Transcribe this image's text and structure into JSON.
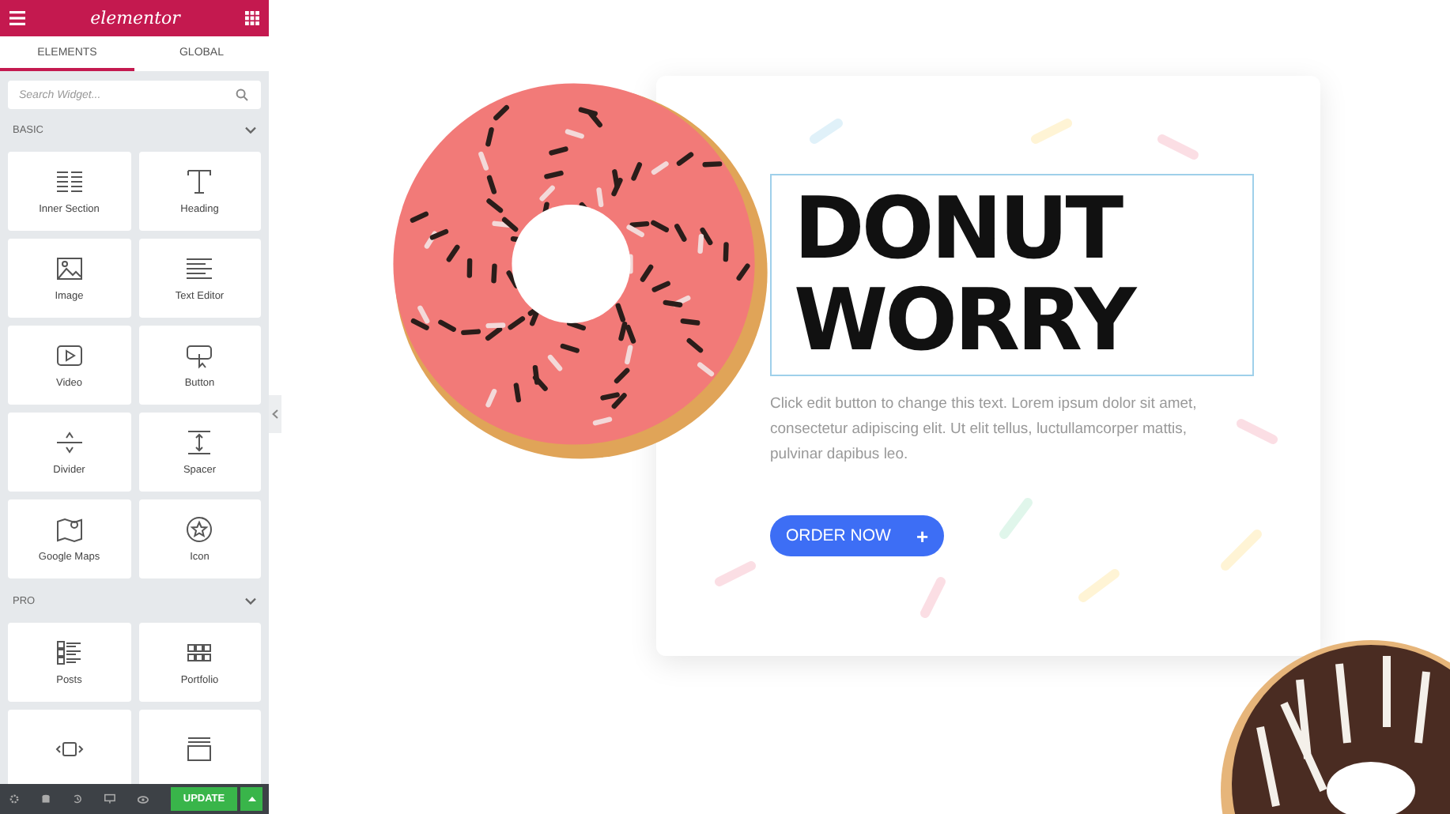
{
  "sidebar": {
    "logo": "elementor",
    "tabs": [
      {
        "label": "ELEMENTS",
        "selected": true
      },
      {
        "label": "GLOBAL",
        "selected": false
      }
    ],
    "search": {
      "placeholder": "Search Widget..."
    },
    "sections": [
      {
        "title": "BASIC",
        "expanded": true,
        "widgets": [
          {
            "kind": "inner-section",
            "label": "Inner Section"
          },
          {
            "kind": "heading",
            "label": "Heading"
          },
          {
            "kind": "image",
            "label": "Image"
          },
          {
            "kind": "text-editor",
            "label": "Text Editor"
          },
          {
            "kind": "video",
            "label": "Video"
          },
          {
            "kind": "button",
            "label": "Button"
          },
          {
            "kind": "divider",
            "label": "Divider"
          },
          {
            "kind": "spacer",
            "label": "Spacer"
          },
          {
            "kind": "map",
            "label": "Google Maps"
          },
          {
            "kind": "icon",
            "label": "Icon"
          }
        ]
      },
      {
        "title": "PRO",
        "expanded": true,
        "widgets": [
          {
            "kind": "posts",
            "label": "Posts"
          },
          {
            "kind": "portfolio",
            "label": "Portfolio"
          },
          {
            "kind": "slides"
          },
          {
            "kind": "form"
          }
        ]
      }
    ],
    "footer": {
      "update_label": "UPDATE"
    }
  },
  "hero": {
    "heading_lines": [
      "DONUT",
      "WORRY"
    ],
    "text": "Click edit button to change this text. Lorem ipsum dolor sit amet, consectetur adipiscing elit. Ut elit tellus, luctullamcorper mattis, pulvinar dapibus leo.",
    "button": {
      "label": "ORDER NOW",
      "icon": "+"
    }
  }
}
